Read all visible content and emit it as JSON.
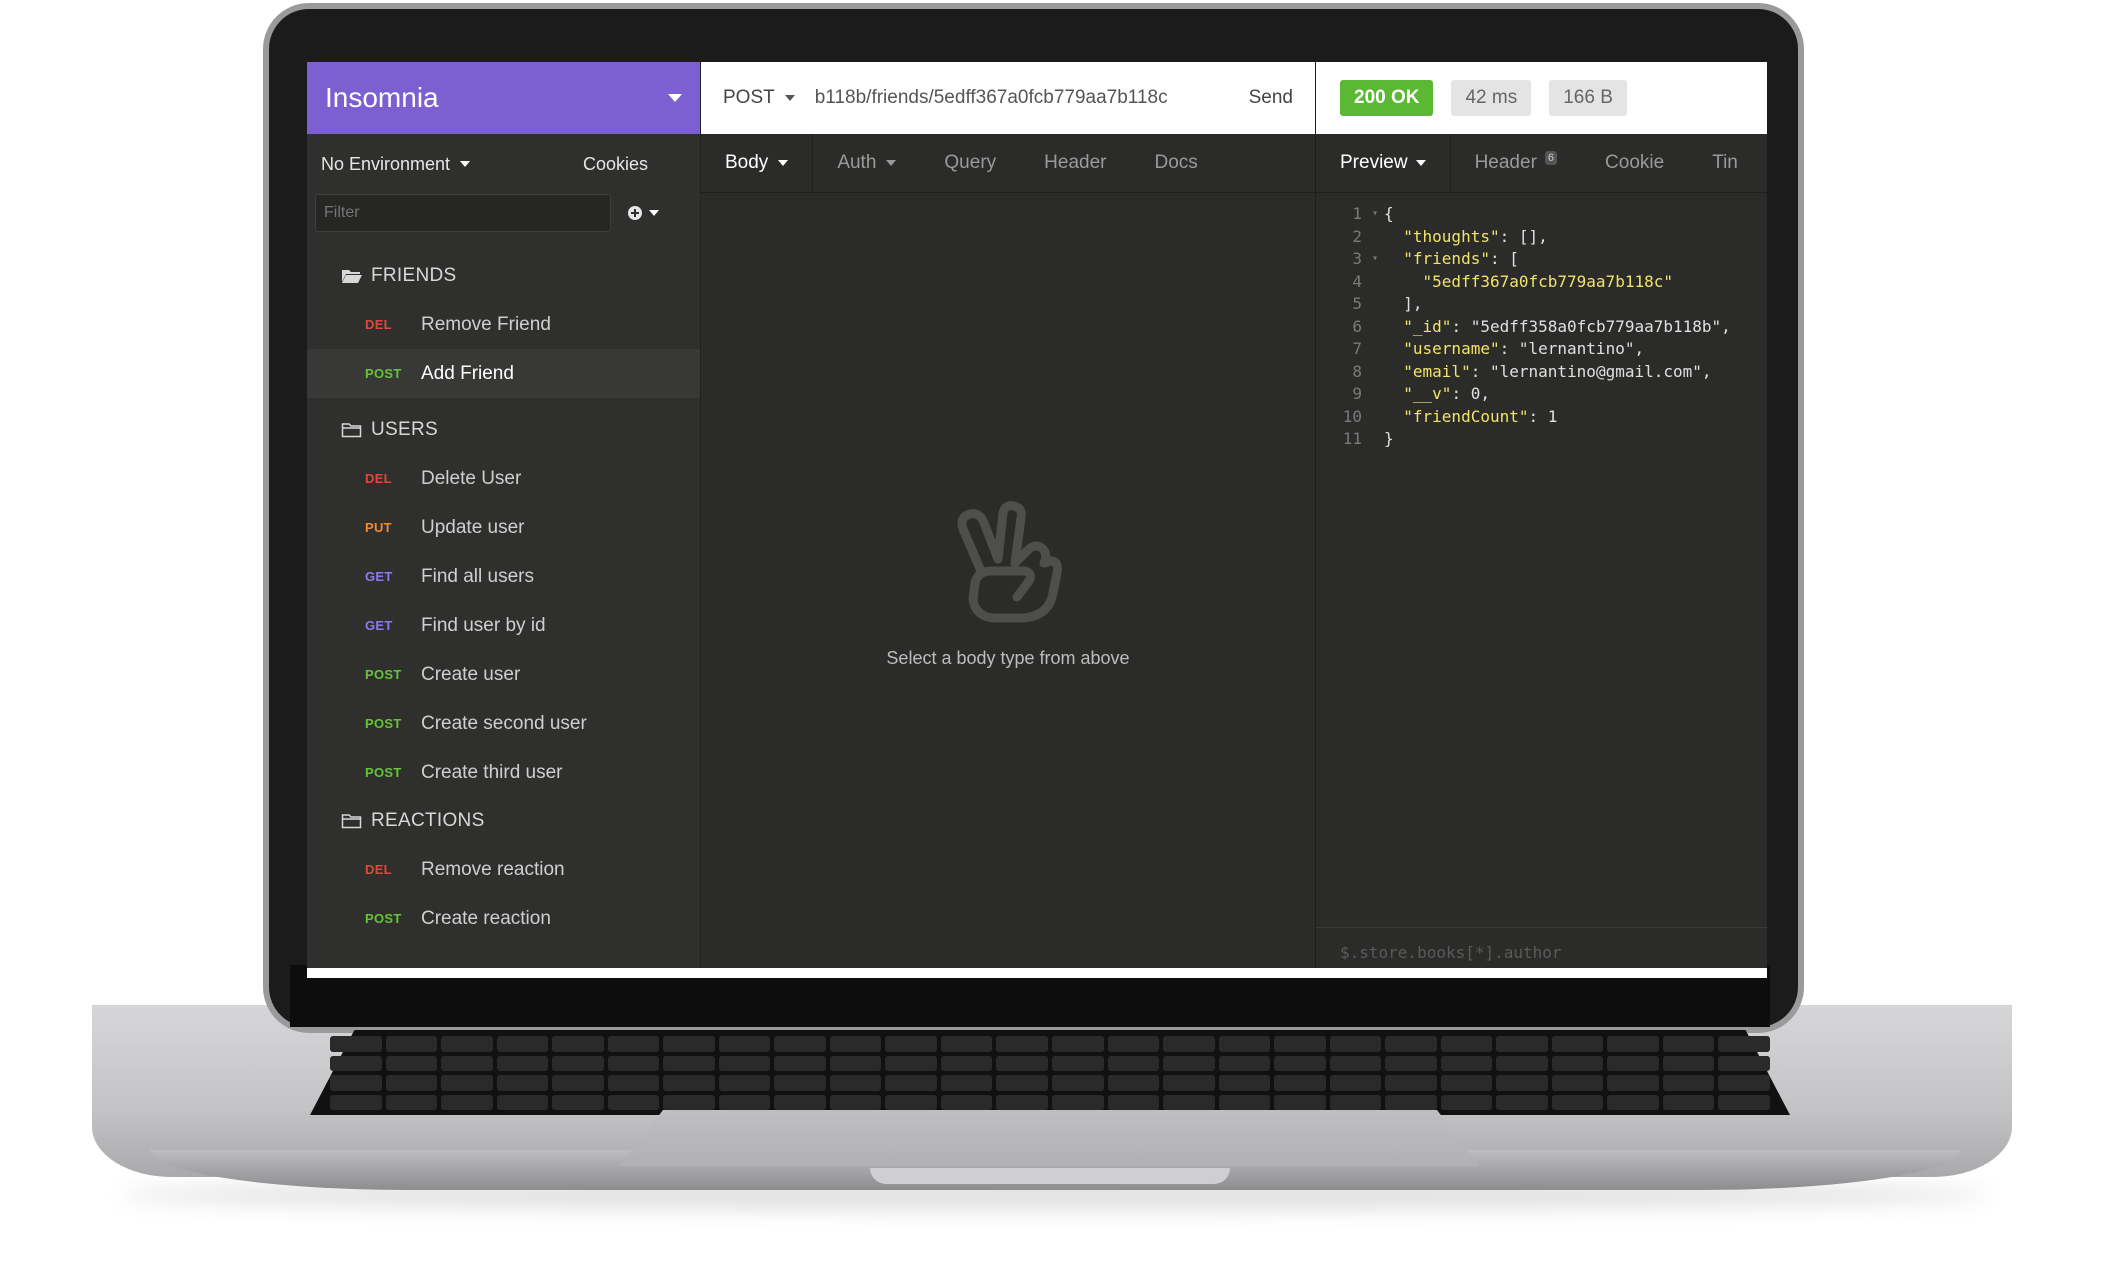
{
  "app": {
    "title": "Insomnia"
  },
  "sidebar": {
    "environment": "No Environment",
    "cookies": "Cookies",
    "filter_placeholder": "Filter",
    "folders": [
      {
        "name": "FRIENDS",
        "open": true,
        "items": [
          {
            "method": "DEL",
            "label": "Remove Friend"
          },
          {
            "method": "POST",
            "label": "Add Friend",
            "active": true
          }
        ]
      },
      {
        "name": "USERS",
        "open": false,
        "items": [
          {
            "method": "DEL",
            "label": "Delete User"
          },
          {
            "method": "PUT",
            "label": "Update user"
          },
          {
            "method": "GET",
            "label": "Find all users"
          },
          {
            "method": "GET",
            "label": "Find user by id"
          },
          {
            "method": "POST",
            "label": "Create user"
          },
          {
            "method": "POST",
            "label": "Create second user"
          },
          {
            "method": "POST",
            "label": "Create third user"
          }
        ]
      },
      {
        "name": "REACTIONS",
        "open": false,
        "items": [
          {
            "method": "DEL",
            "label": "Remove reaction"
          },
          {
            "method": "POST",
            "label": "Create reaction"
          }
        ]
      }
    ]
  },
  "method_colors": {
    "DEL": "#e0483b",
    "POST": "#66c43a",
    "PUT": "#ef8a2f",
    "GET": "#8a7bf0"
  },
  "request": {
    "method": "POST",
    "url": "b118b/friends/5edff367a0fcb779aa7b118c",
    "send": "Send",
    "tabs": [
      "Body",
      "Auth",
      "Query",
      "Header",
      "Docs"
    ],
    "empty_text": "Select a body type from above"
  },
  "response": {
    "status": "200 OK",
    "time": "42 ms",
    "size": "166 B",
    "tabs": [
      "Preview",
      "Header",
      "Cookie",
      "Tin"
    ],
    "header_count": "6",
    "filter_placeholder": "$.store.books[*].author"
  },
  "code_lines": [
    "{",
    "  \"thoughts\": [],",
    "  \"friends\": [",
    "    \"5edff367a0fcb779aa7b118c\"",
    "  ],",
    "  \"_id\": \"5edff358a0fcb779aa7b118b\",",
    "  \"username\": \"lernantino\",",
    "  \"email\": \"lernantino@gmail.com\",",
    "  \"__v\": 0,",
    "  \"friendCount\": 1",
    "}"
  ]
}
